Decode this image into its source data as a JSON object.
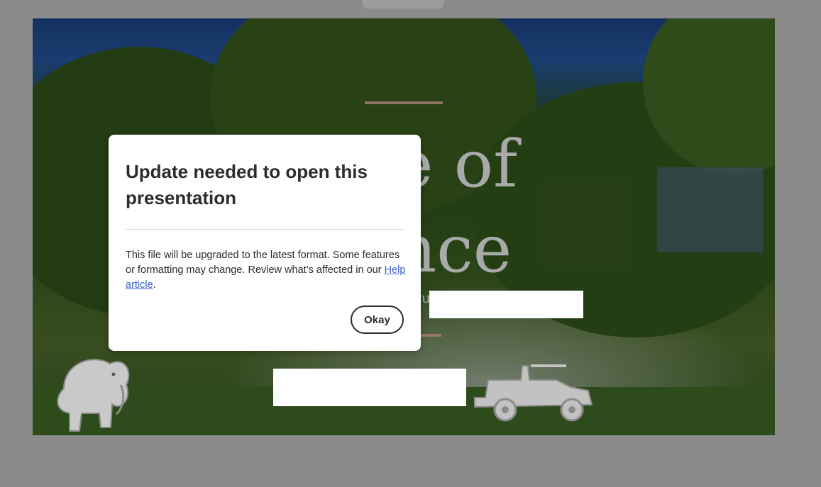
{
  "slide": {
    "title_line1": "e of",
    "title_line2": "nce",
    "subtitle_partial": "ou"
  },
  "dialog": {
    "title": "Update needed to open this presentation",
    "body": "This file will be upgraded to the latest format. Some features or formatting may change. Review what’s affected in our ",
    "link_text": "Help article",
    "body_end": ".",
    "ok_label": "Okay"
  },
  "colors": {
    "link": "#3e63c9",
    "text": "#2c2c2c",
    "overlay": "#8b8b8b"
  },
  "icons": [
    "elephant-icon",
    "jeep-icon"
  ]
}
